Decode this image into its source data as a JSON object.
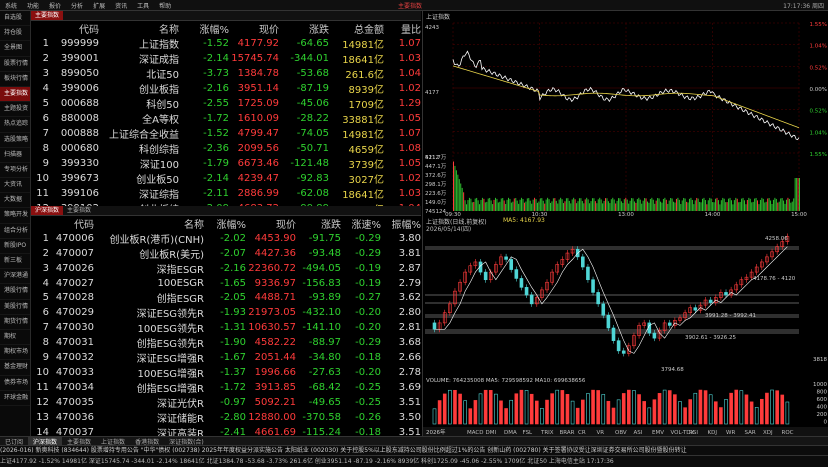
{
  "menubar": {
    "items": [
      "系统",
      "功能",
      "报价",
      "分析",
      "扩展",
      "资讯",
      "工具",
      "帮助"
    ],
    "window_title": "主要指数",
    "right_text": "17:17:36 周四"
  },
  "sidebar": {
    "items": [
      "自选股",
      "持仓股",
      "全景图",
      "股票行情",
      "板块行情",
      "主要指数",
      "主题投资",
      "热点追踪",
      "选股策略",
      "扫描器",
      "专项分析",
      "大资讯",
      "大数据",
      "策略开发",
      "组合分析",
      "新股IPO",
      "新三板",
      "沪深港通",
      "港股行情",
      "美股行情",
      "期货行情",
      "期权",
      "期权市场",
      "基金理财",
      "债券市场",
      "环球金融"
    ],
    "active_index": 5
  },
  "index_table": {
    "tabs": [
      "主要指数"
    ],
    "headers": [
      "",
      "代码",
      "名称",
      "涨幅%",
      "现价",
      "涨跌",
      "总金额",
      "量比"
    ],
    "rows": [
      [
        "1",
        "999999",
        "上证指数",
        "-1.52",
        "4177.92",
        "-64.65",
        "14981亿",
        "1.07"
      ],
      [
        "2",
        "399001",
        "深证成指",
        "-2.14",
        "15745.74",
        "-344.01",
        "18641亿",
        "1.03"
      ],
      [
        "3",
        "899050",
        "北证50",
        "-3.73",
        "1384.78",
        "-53.68",
        "261.6亿",
        "1.04"
      ],
      [
        "4",
        "399006",
        "创业板指",
        "-2.16",
        "3951.14",
        "-87.19",
        "8939亿",
        "1.02"
      ],
      [
        "5",
        "000688",
        "科创50",
        "-2.55",
        "1725.09",
        "-45.06",
        "1709亿",
        "1.29"
      ],
      [
        "6",
        "880008",
        "全A等权",
        "-1.72",
        "1610.09",
        "-28.22",
        "33881亿",
        "1.05"
      ],
      [
        "7",
        "000888",
        "上证综合全收益",
        "-1.52",
        "4799.47",
        "-74.05",
        "14981亿",
        "1.07"
      ],
      [
        "8",
        "000680",
        "科创综指",
        "-2.36",
        "2099.56",
        "-50.71",
        "4659亿",
        "1.08"
      ],
      [
        "9",
        "399330",
        "深证100",
        "-1.79",
        "6673.46",
        "-121.48",
        "3739亿",
        "1.05"
      ],
      [
        "10",
        "399673",
        "创业板50",
        "-2.14",
        "4239.47",
        "-92.83",
        "3027亿",
        "1.02"
      ],
      [
        "11",
        "399106",
        "深证综指",
        "-2.11",
        "2886.99",
        "-62.08",
        "18641亿",
        "1.03"
      ],
      [
        "12",
        "399102",
        "创业板综",
        "-2.09",
        "4683.72",
        "-99.89",
        "8939亿",
        "1.04"
      ]
    ]
  },
  "cn_table": {
    "tabs": [
      "沪深指数",
      "主要指数"
    ],
    "headers": [
      "",
      "代码",
      "名称",
      "涨幅%",
      "现价",
      "涨跌",
      "涨速%",
      "振幅%"
    ],
    "rows": [
      [
        "1",
        "470006",
        "创业板R(港币)(CNH)",
        "-2.02",
        "4453.90",
        "-91.75",
        "-0.29",
        "3.80"
      ],
      [
        "2",
        "470007",
        "创业板R(美元)",
        "-2.07",
        "4427.36",
        "-93.48",
        "-0.29",
        "3.81"
      ],
      [
        "3",
        "470026",
        "深指ESGR",
        "-2.16",
        "22360.72",
        "-494.05",
        "-0.19",
        "2.87"
      ],
      [
        "4",
        "470027",
        "100ESGR",
        "-1.65",
        "9336.97",
        "-156.83",
        "-0.19",
        "2.79"
      ],
      [
        "5",
        "470028",
        "创指ESGR",
        "-2.05",
        "4488.71",
        "-93.89",
        "-0.27",
        "3.62"
      ],
      [
        "6",
        "470029",
        "深证ESG领先R",
        "-1.93",
        "21973.05",
        "-432.10",
        "-0.20",
        "2.80"
      ],
      [
        "7",
        "470030",
        "100ESG领先R",
        "-1.31",
        "10630.57",
        "-141.10",
        "-0.20",
        "2.81"
      ],
      [
        "8",
        "470031",
        "创指ESG领先R",
        "-1.90",
        "4582.22",
        "-88.97",
        "-0.29",
        "3.68"
      ],
      [
        "9",
        "470032",
        "深证ESG增强R",
        "-1.67",
        "2051.44",
        "-34.80",
        "-0.18",
        "2.66"
      ],
      [
        "10",
        "470033",
        "100ESG增强R",
        "-1.37",
        "1996.66",
        "-27.63",
        "-0.20",
        "2.78"
      ],
      [
        "11",
        "470034",
        "创指ESG增强R",
        "-1.72",
        "3913.85",
        "-68.42",
        "-0.25",
        "3.69"
      ],
      [
        "12",
        "470035",
        "深证光伏R",
        "-0.97",
        "5092.21",
        "-49.65",
        "-0.25",
        "3.51"
      ],
      [
        "13",
        "470036",
        "深证储能R",
        "-2.80",
        "12880.00",
        "-370.58",
        "-0.26",
        "3.50"
      ],
      [
        "14",
        "470037",
        "深证高装R",
        "-2.41",
        "4661.69",
        "-115.24",
        "-0.18",
        "3.51"
      ]
    ]
  },
  "intraday": {
    "title": "上证指数",
    "price_labels": [
      "4243",
      "4177",
      "4112"
    ],
    "pct_labels": [
      "1.55%",
      "1.04%",
      "0.52%",
      "0.00%",
      "0.52%",
      "1.04%",
      "1.55%"
    ],
    "vol_labels": [
      "521.7万",
      "447.1万",
      "372.6万",
      "298.1万",
      "223.6万",
      "149.0万",
      "745124"
    ],
    "time_labels": [
      "09:30",
      "10:30",
      "13:00",
      "14:00",
      "15:00"
    ],
    "close_price": 4177.92,
    "colors": {
      "price": "#ffffff",
      "avg": "#e8d44a",
      "vol": "#2fbf2f",
      "grid": "#5a0000"
    }
  },
  "kline": {
    "title": "上证指数(日线,前复权)",
    "date": "2026/05/14(四)",
    "ma_text": "MA5: 4167.93",
    "annotations": [
      "4258.06",
      "4178.76 - 4120",
      "3991.28 - 3992.41",
      "3902.61 - 3926.25",
      "3794.68"
    ],
    "volume_label": "VOLUME: 764235008  MA5: 729598592  MA10: 699638656",
    "indicators": [
      "MACD",
      "DMI",
      "DMA",
      "FSL",
      "TRIX",
      "BRAR",
      "CR",
      "VR",
      "OBV",
      "ASI",
      "EMV",
      "VOL-TDX",
      "RSI",
      "KDJ",
      "WR",
      "SAR",
      "XDJ",
      "ROC"
    ],
    "right_labels": [
      "3818",
      "3818"
    ],
    "vol_axis": [
      "1000",
      "800",
      "600",
      "400",
      "200",
      "0"
    ],
    "year_label": "2026年"
  },
  "tabbar": {
    "items": [
      "已订阅",
      "沪深指数",
      "主要指数",
      "上证指数",
      "香港指数",
      "深证指数(合)"
    ],
    "active_index": 1
  },
  "newsbar": {
    "text": "(2026-016)   新奥科技 (834644) 股票增持专用公告   \"中华\"债权 (002738) 2025年年度权益分派实施公告   太阳纸业 (002030) 关于控股5%以上股东减持公司股份比例超过1%的公告   创新山药 (002780) 关于签署协议受让深圳证券交易所公司股份暨股份转让"
  },
  "statusbar": {
    "text": "上证4177.92 -1.52% 14981亿   深证15745.74 -344.01 -2.14% 18641亿   北证1384.78 -53.68 -3.73% 261.6亿   创业3951.14 -87.19 -2.16% 8939亿   科创1725.09 -45.06 -2.55% 1709亿   北证50 上海电信主站 17:17:36"
  }
}
